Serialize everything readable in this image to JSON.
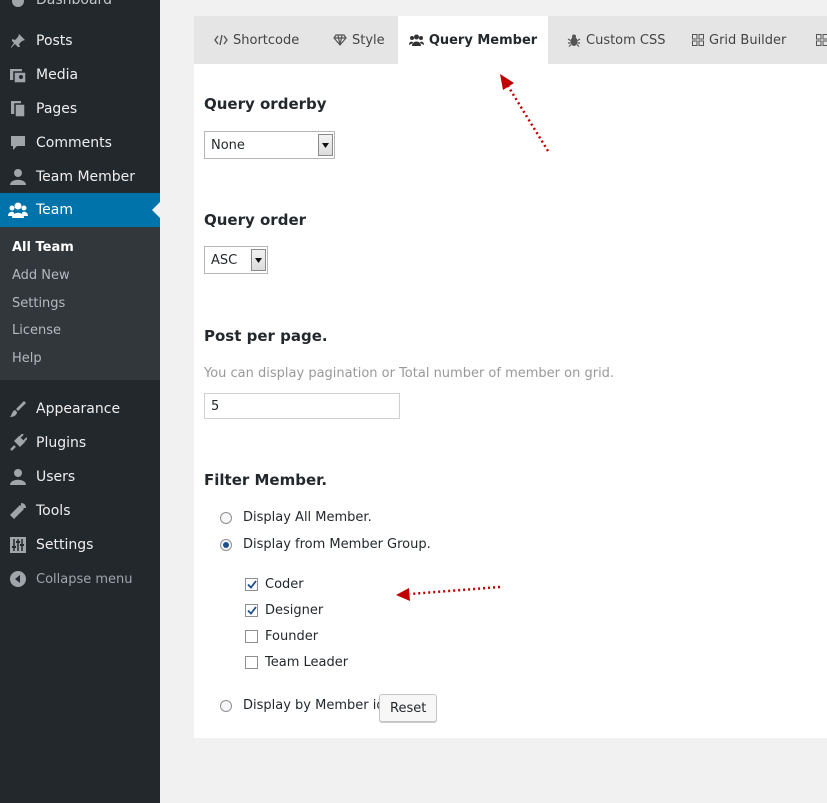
{
  "sidebar": {
    "top_clipped": "Dashboard",
    "items": [
      {
        "label": "Posts",
        "icon": "pin-icon"
      },
      {
        "label": "Media",
        "icon": "media-icon"
      },
      {
        "label": "Pages",
        "icon": "pages-icon"
      },
      {
        "label": "Comments",
        "icon": "comment-icon"
      },
      {
        "label": "Team Member",
        "icon": "user-icon"
      },
      {
        "label": "Team",
        "icon": "group-icon"
      },
      {
        "label": "Appearance",
        "icon": "brush-icon"
      },
      {
        "label": "Plugins",
        "icon": "plug-icon"
      },
      {
        "label": "Users",
        "icon": "user-icon"
      },
      {
        "label": "Tools",
        "icon": "wrench-icon"
      },
      {
        "label": "Settings",
        "icon": "sliders-icon"
      }
    ],
    "submenu": [
      "All Team",
      "Add New",
      "Settings",
      "License",
      "Help"
    ],
    "collapse": "Collapse menu"
  },
  "tabs": [
    {
      "label": "Shortcode",
      "icon": "code-icon"
    },
    {
      "label": "Style",
      "icon": "diamond-icon"
    },
    {
      "label": "Query Member",
      "icon": "group-icon"
    },
    {
      "label": "Custom CSS",
      "icon": "bug-icon"
    },
    {
      "label": "Grid Builder",
      "icon": "grid-icon"
    }
  ],
  "query_orderby": {
    "title": "Query orderby",
    "value": "None"
  },
  "query_order": {
    "title": "Query order",
    "value": "ASC"
  },
  "post_per_page": {
    "title": "Post per page.",
    "help": "You can display pagination or Total number of member on grid.",
    "value": "5"
  },
  "filter": {
    "title": "Filter Member.",
    "options": [
      "Display All Member.",
      "Display from Member Group.",
      "Display by Member id."
    ],
    "selected": 1,
    "groups": [
      {
        "label": "Coder",
        "checked": true
      },
      {
        "label": "Designer",
        "checked": true
      },
      {
        "label": "Founder",
        "checked": false
      },
      {
        "label": "Team Leader",
        "checked": false
      }
    ],
    "reset_label": "Reset"
  },
  "colors": {
    "sidebar_bg": "#23282d",
    "active_menu": "#0073aa",
    "arrow_annotation": "#c00000"
  }
}
